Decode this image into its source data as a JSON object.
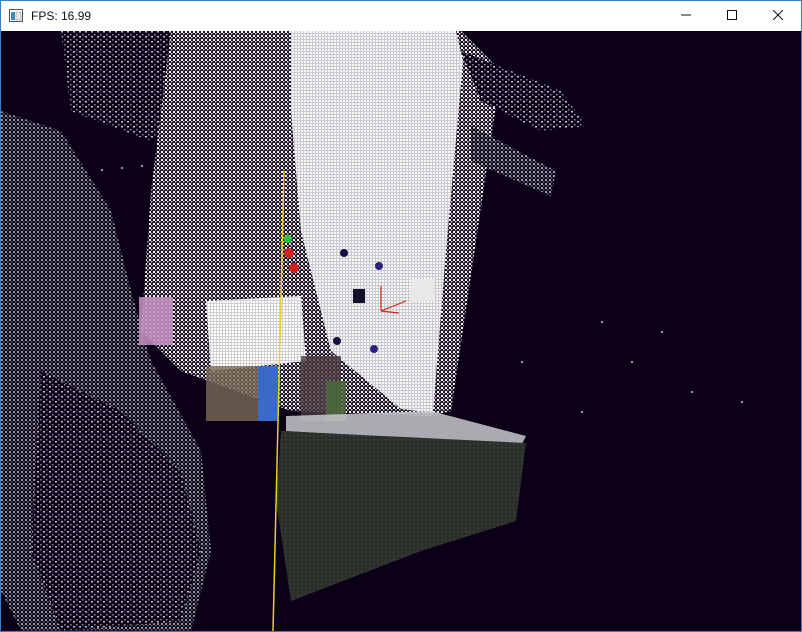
{
  "window": {
    "title": "FPS: 16.99",
    "icon": "app-window-icon",
    "controls": [
      {
        "name": "minimize",
        "icon": "minimize-icon"
      },
      {
        "name": "maximize",
        "icon": "maximize-icon"
      },
      {
        "name": "close",
        "icon": "close-icon"
      }
    ]
  },
  "viewport": {
    "content": "point-cloud-render",
    "background_color": "#0b0018"
  }
}
